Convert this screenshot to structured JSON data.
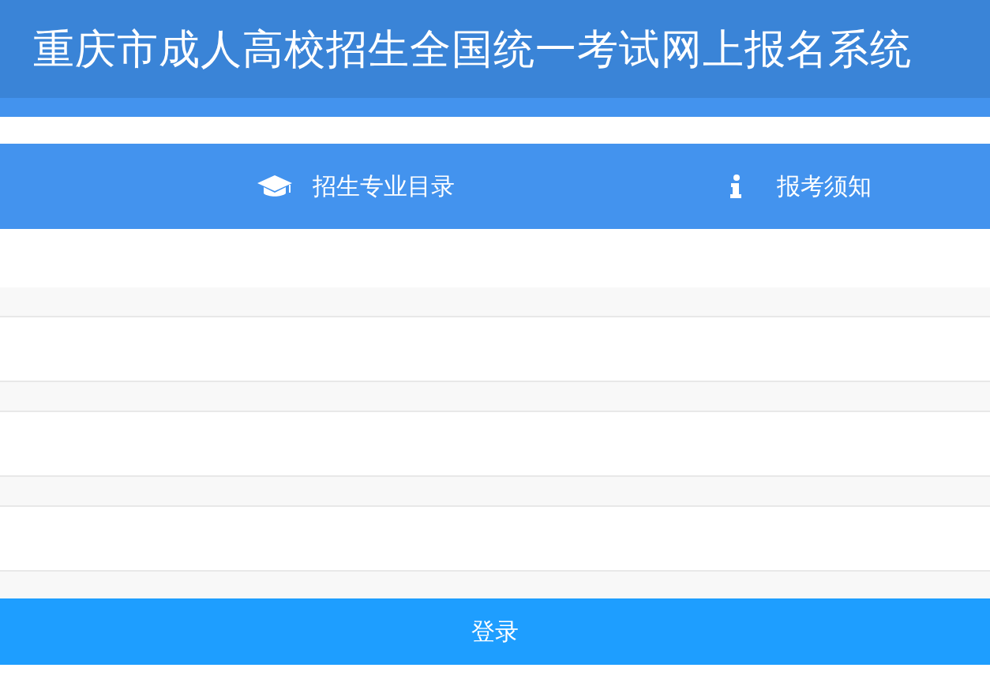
{
  "header": {
    "title": "重庆市成人高校招生全国统一考试网上报名系统"
  },
  "nav": {
    "items": [
      {
        "kind": "catalog",
        "label": "招生专业目录"
      },
      {
        "kind": "notice",
        "label": "报考须知"
      }
    ]
  },
  "form": {
    "fields": [
      {
        "kind": "text"
      },
      {
        "kind": "text"
      },
      {
        "kind": "text"
      }
    ],
    "submit": "登录"
  }
}
